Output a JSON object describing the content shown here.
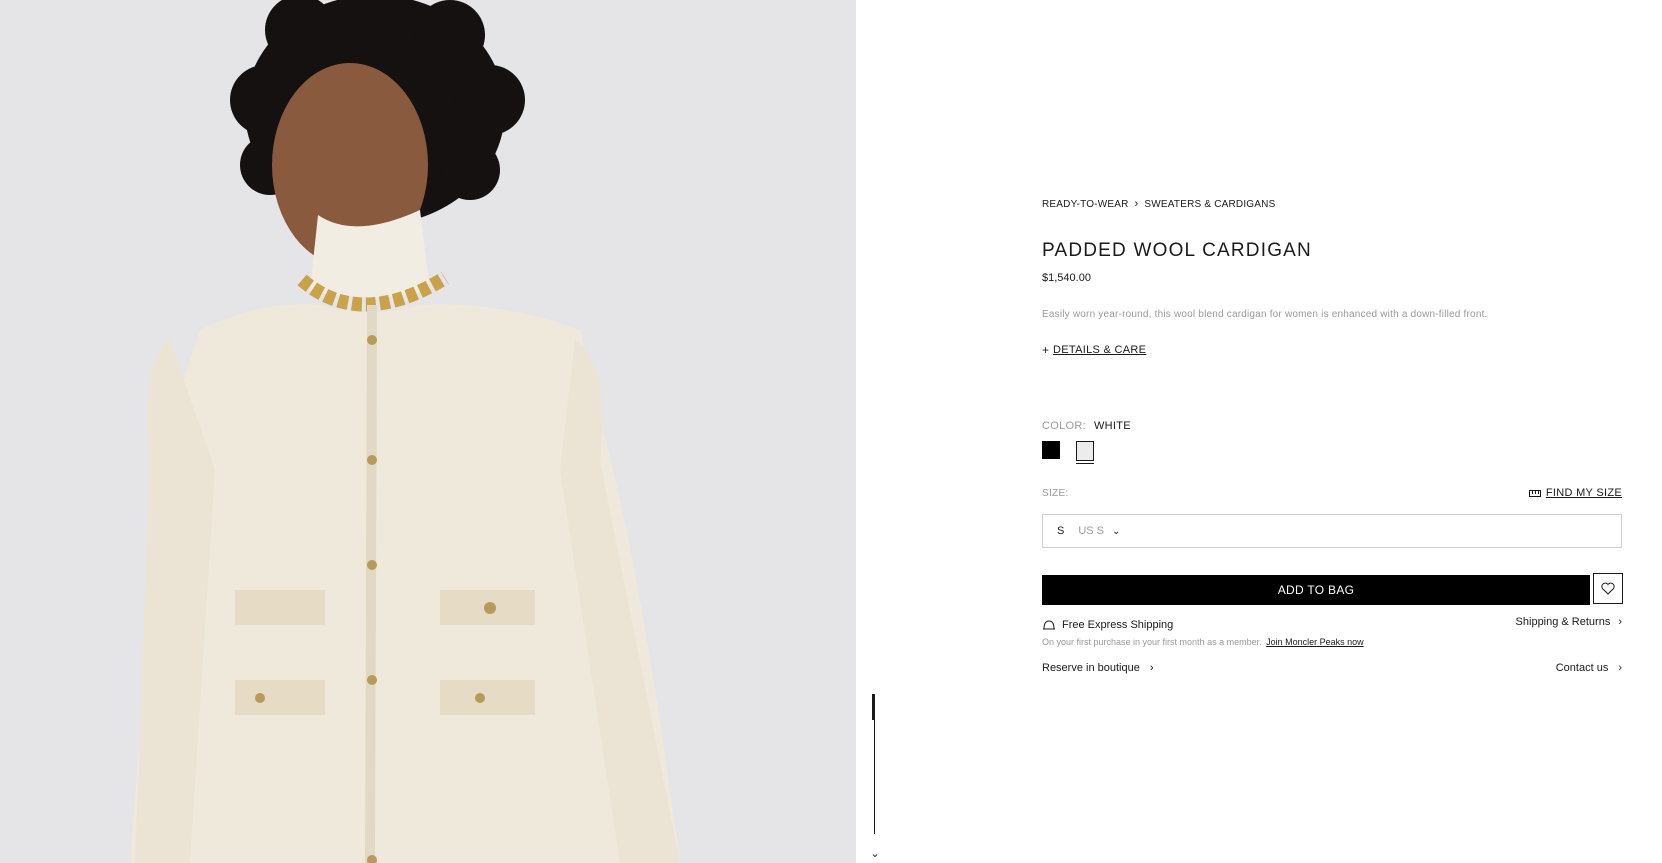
{
  "gallery": {
    "image_alt": "",
    "scroll_down_icon": "double-chevron-down-icon"
  },
  "breadcrumb": {
    "items": [
      "READY-TO-WEAR",
      "SWEATERS & CARDIGANS"
    ],
    "separator_icon": "chevron-right-icon"
  },
  "product": {
    "title": "PADDED WOOL CARDIGAN",
    "price": "$1,540.00",
    "description": "Easily worn year-round, this wool blend cardigan for women is enhanced with a down-filled front.",
    "details_care_label": "DETAILS & CARE"
  },
  "color": {
    "label": "COLOR:",
    "selected": "WHITE",
    "options": [
      {
        "name": "black",
        "hex": "#000000"
      },
      {
        "name": "white",
        "hex": "#ececec",
        "selected": true
      }
    ]
  },
  "size": {
    "label": "SIZE:",
    "find_my_size": "FIND MY SIZE",
    "selected": "S",
    "us_size": "US S"
  },
  "actions": {
    "add_to_bag": "ADD TO BAG",
    "wishlist_icon": "heart-icon"
  },
  "shipping": {
    "free_express": "Free Express Shipping",
    "returns_link": "Shipping & Returns",
    "member_text": "On your first purchase in your first month as a member.",
    "member_link": "Join Moncler Peaks now"
  },
  "links": {
    "reserve": "Reserve in boutique",
    "contact": "Contact us"
  },
  "colors": {
    "accent": "#000000",
    "muted_text": "#9a9a9a",
    "image_bg": "#e5e4e6"
  }
}
